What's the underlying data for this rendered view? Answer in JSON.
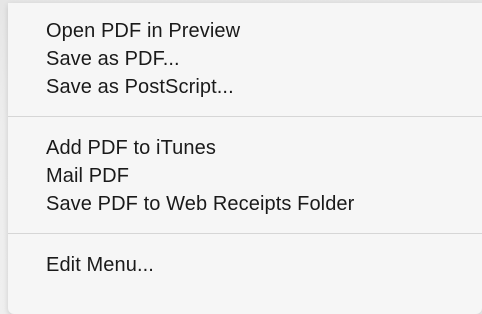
{
  "menu": {
    "groups": [
      {
        "items": [
          {
            "label": "Open PDF in Preview"
          },
          {
            "label": "Save as PDF..."
          },
          {
            "label": "Save as PostScript..."
          }
        ]
      },
      {
        "items": [
          {
            "label": "Add PDF to iTunes"
          },
          {
            "label": "Mail PDF"
          },
          {
            "label": "Save PDF to Web Receipts Folder"
          }
        ]
      },
      {
        "items": [
          {
            "label": "Edit Menu..."
          }
        ]
      }
    ]
  }
}
